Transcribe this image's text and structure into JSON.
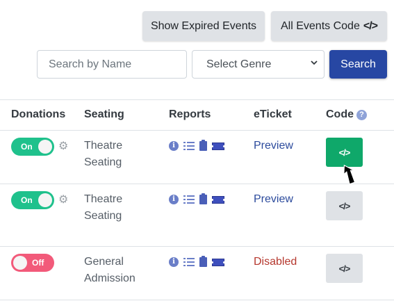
{
  "toolbar": {
    "show_expired_label": "Show Expired Events",
    "all_events_code_label": "All Events Code",
    "code_glyph": "</>"
  },
  "search": {
    "placeholder": "Search by Name",
    "genre_select": "Select Genre",
    "button_label": "Search"
  },
  "table": {
    "headers": {
      "donations": "Donations",
      "seating": "Seating",
      "reports": "Reports",
      "eticket": "eTicket",
      "code": "Code",
      "code_help": "?"
    },
    "rows": [
      {
        "donation_state": "On",
        "seating_line1": "Theatre",
        "seating_line2": "Seating",
        "eticket": "Preview",
        "code_glyph": "</>"
      },
      {
        "donation_state": "On",
        "seating_line1": "Theatre",
        "seating_line2": "Seating",
        "eticket": "Preview",
        "code_glyph": "</>"
      },
      {
        "donation_state": "Off",
        "seating_line1": "General",
        "seating_line2": "Admission",
        "eticket": "Disabled",
        "code_glyph": "</>"
      }
    ]
  },
  "icons": {
    "info": "i",
    "gear": "⚙",
    "chevron": "⌄"
  },
  "colors": {
    "toggle_on": "#1fc18c",
    "toggle_off": "#f25a7a",
    "primary": "#2747a3",
    "code_active": "#0fa86a",
    "link": "#2b4a9c",
    "disabled": "#b5372d"
  }
}
